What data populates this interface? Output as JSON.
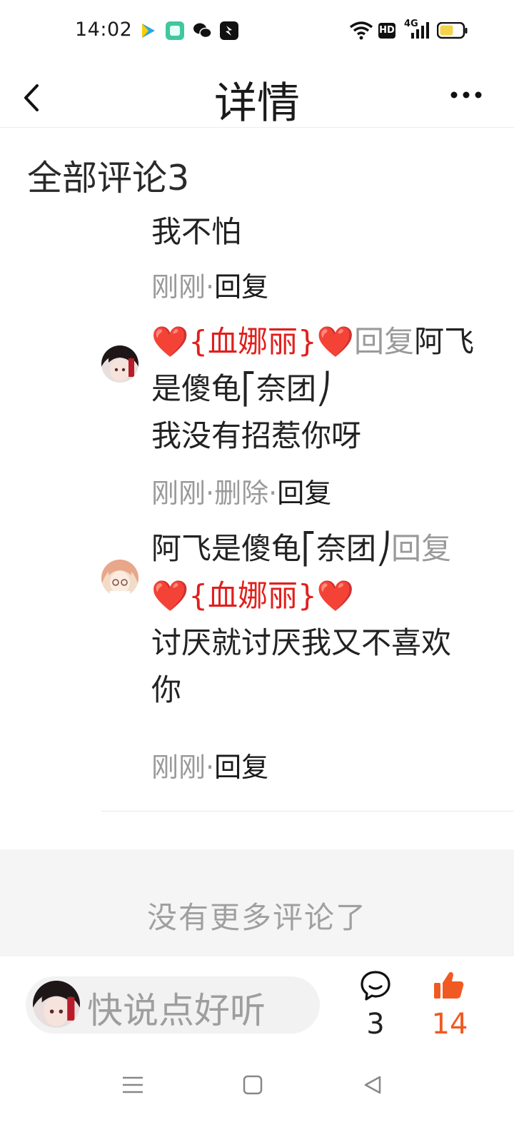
{
  "status_bar": {
    "time": "14:02",
    "network": "4G",
    "hd": "HD",
    "icons": [
      "video-app-icon",
      "green-app-icon",
      "wechat-icon",
      "tiktok-icon",
      "wifi-icon",
      "signal-icon",
      "battery-icon"
    ]
  },
  "header": {
    "title": "详情",
    "icons": [
      "back-arrow-icon",
      "more-icon"
    ]
  },
  "section": {
    "title": "全部评论3"
  },
  "comments": [
    {
      "text": "我不怕",
      "time": "刚刚",
      "sep": "·",
      "reply": "回复"
    },
    {
      "from": "❤️{血娜丽}❤️",
      "reply_word": "回复",
      "to": "阿飞是傻龟⎡奈团⎠",
      "text": "我没有招惹你呀",
      "time": "刚刚",
      "sep": "·",
      "delete": "删除",
      "reply": "回复"
    },
    {
      "from": "阿飞是傻龟⎡奈团⎠",
      "reply_word": "回复",
      "to": "❤️{血娜丽}❤️",
      "text": "讨厌就讨厌我又不喜欢你",
      "time": "刚刚",
      "sep": "·",
      "reply": "回复"
    }
  ],
  "footer_note": "没有更多评论了",
  "bottom_bar": {
    "placeholder": "快说点好听",
    "comment_count": "3",
    "like_count": "14"
  },
  "colors": {
    "accent": "#f05a22",
    "heart": "#e0201d",
    "meta_gray": "#9a9a9a"
  }
}
